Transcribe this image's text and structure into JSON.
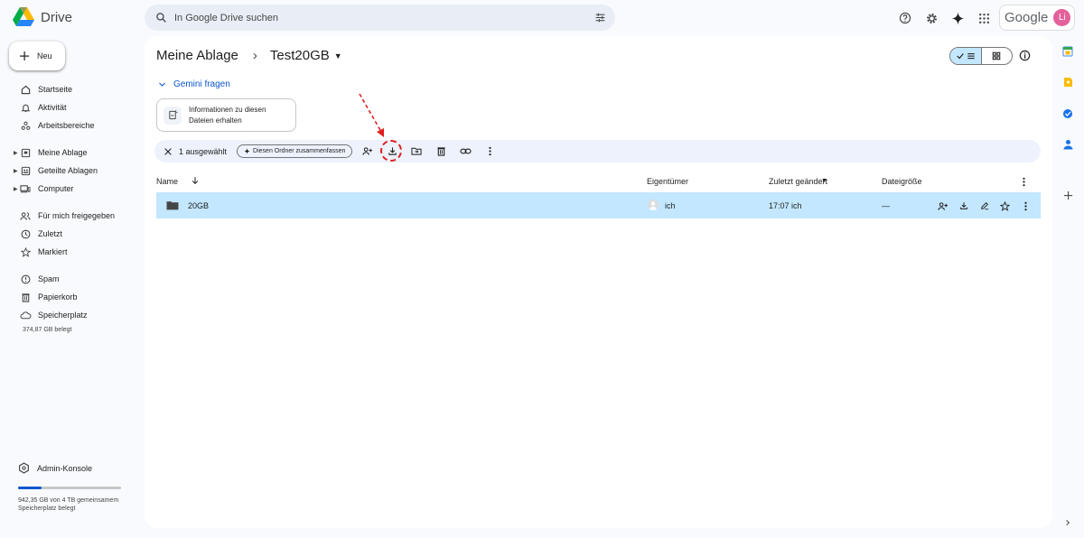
{
  "header": {
    "app_name": "Drive",
    "search_placeholder": "In Google Drive suchen",
    "google_wordmark": "Google",
    "avatar_letter": "Li"
  },
  "sidebar": {
    "new_label": "Neu",
    "items": [
      {
        "label": "Startseite",
        "icon": "home-icon"
      },
      {
        "label": "Aktivität",
        "icon": "bell-icon"
      },
      {
        "label": "Arbeitsbereiche",
        "icon": "workspaces-icon"
      },
      {
        "label": "Meine Ablage",
        "icon": "my-drive-icon"
      },
      {
        "label": "Geteilte Ablagen",
        "icon": "shared-drives-icon"
      },
      {
        "label": "Computer",
        "icon": "computer-icon"
      },
      {
        "label": "Für mich freigegeben",
        "icon": "shared-with-me-icon"
      },
      {
        "label": "Zuletzt",
        "icon": "clock-icon"
      },
      {
        "label": "Markiert",
        "icon": "star-icon"
      },
      {
        "label": "Spam",
        "icon": "spam-icon"
      },
      {
        "label": "Papierkorb",
        "icon": "trash-icon"
      },
      {
        "label": "Speicherplatz",
        "icon": "cloud-icon"
      }
    ],
    "storage_used": "374,87 GB belegt",
    "admin_label": "Admin-Konsole",
    "org_storage_text": "942,35 GB von 4 TB gemeinsamem Speicherplatz belegt",
    "org_storage_fraction": 0.23
  },
  "main": {
    "breadcrumb_root": "Meine Ablage",
    "breadcrumb_current": "Test20GB",
    "gemini_label": "Gemini fragen",
    "gemini_chip": "Informationen zu diesen Dateien erhalten",
    "selection": {
      "count_label": "1 ausgewählt",
      "summarize_label": "Diesen Ordner zusammenfassen"
    },
    "columns": {
      "name": "Name",
      "owner": "Eigentümer",
      "modified": "Zuletzt geändert",
      "size": "Dateigröße"
    },
    "rows": [
      {
        "name": "20GB",
        "owner": "ich",
        "modified": "17:07 ich",
        "size": "—"
      }
    ]
  },
  "colors": {
    "accent": "#0b57d0",
    "selection": "#c2e7ff",
    "highlight": "#e02020"
  }
}
